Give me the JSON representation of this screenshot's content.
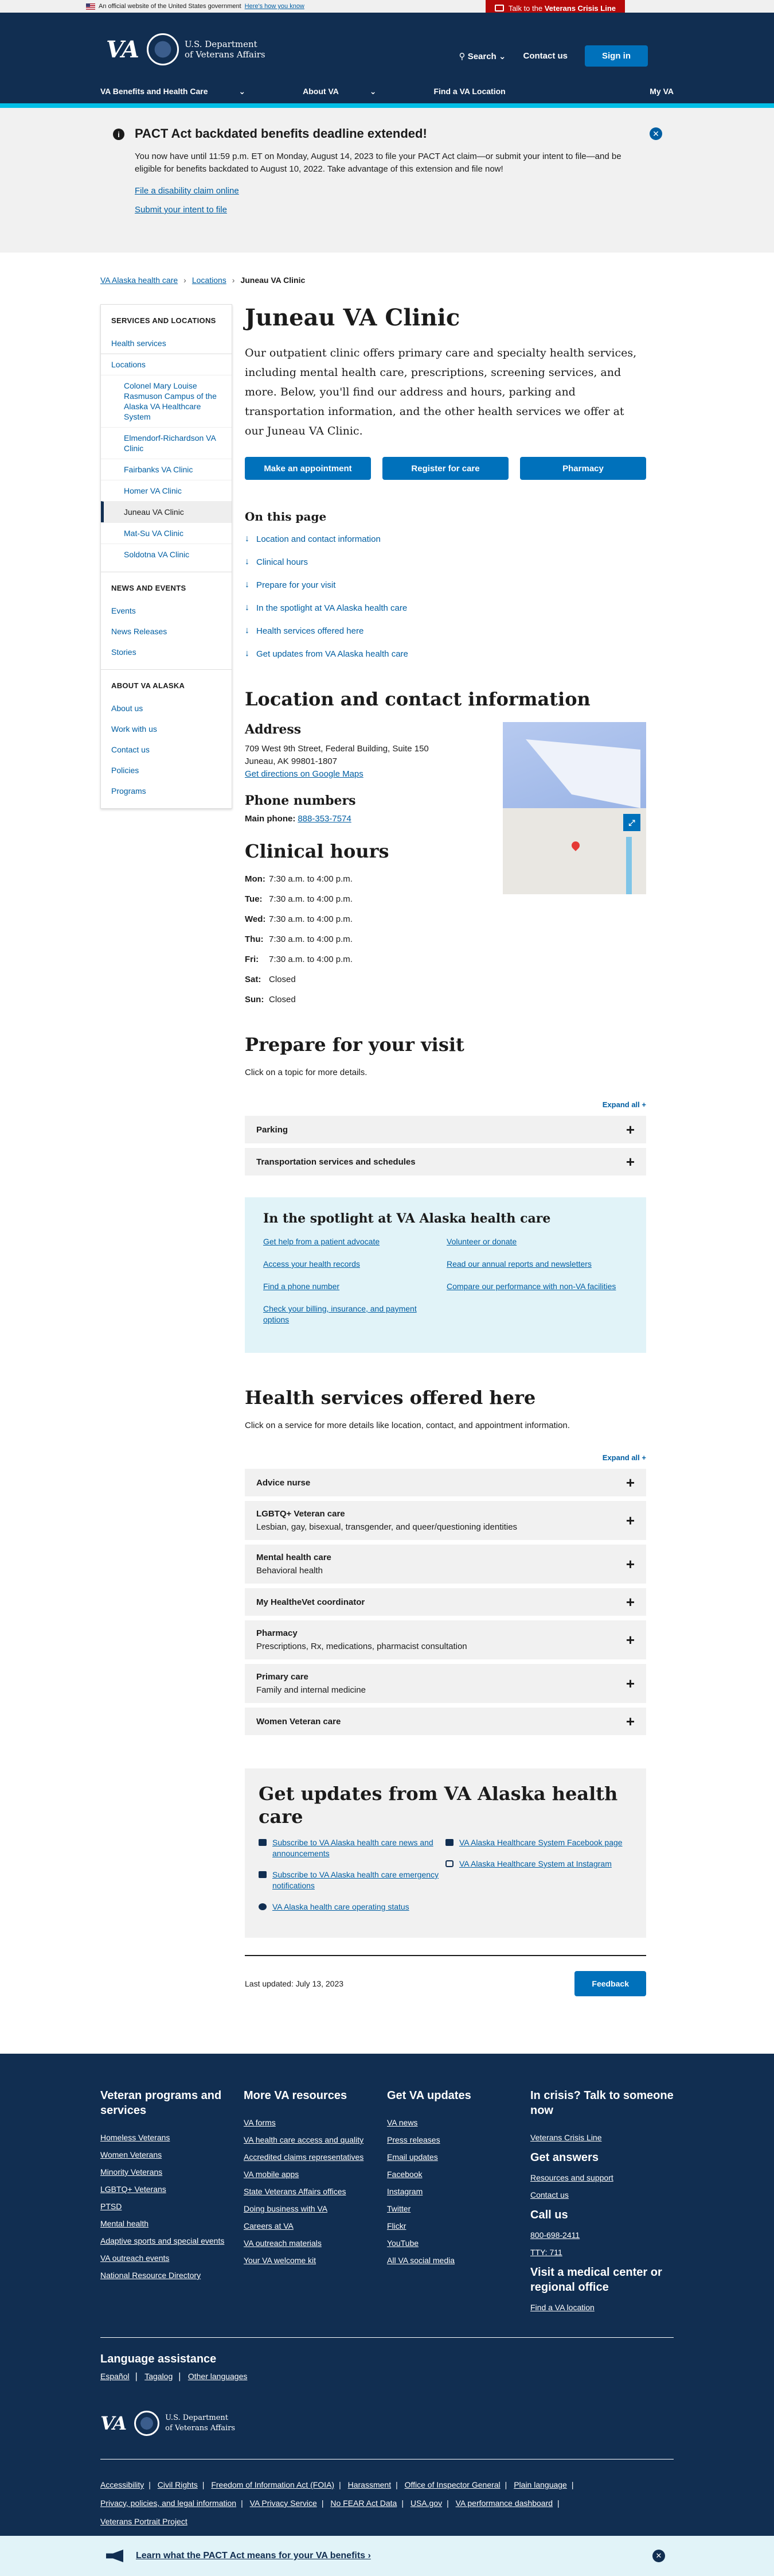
{
  "gov_banner": {
    "text": "An official website of the United States government",
    "how": "Here's how you know"
  },
  "crisis": {
    "prefix": "Talk to the",
    "bold": "Veterans Crisis Line"
  },
  "header": {
    "logo": "VA",
    "dept_line1": "U.S. Department",
    "dept_line2": "of Veterans Affairs",
    "search": "Search",
    "contact": "Contact us",
    "signin": "Sign in",
    "nav": [
      "VA Benefits and Health Care",
      "About VA",
      "Find a VA Location"
    ],
    "myva": "My VA"
  },
  "alert": {
    "title": "PACT Act backdated benefits deadline extended!",
    "body": "You now have until 11:59 p.m. ET on Monday, August 14, 2023 to file your PACT Act claim—or submit your intent to file—and be eligible for benefits backdated to August 10, 2022. Take advantage of this extension and file now!",
    "link1": "File a disability claim online",
    "link2": "Submit your intent to file"
  },
  "breadcrumb": [
    "VA Alaska health care",
    "Locations",
    "Juneau VA Clinic"
  ],
  "sidebar": {
    "heading1": "SERVICES AND LOCATIONS",
    "health_services": "Health services",
    "locations": "Locations",
    "location_items": [
      "Colonel Mary Louise Rasmuson Campus of the Alaska VA Healthcare System",
      "Elmendorf-Richardson VA Clinic",
      "Fairbanks VA Clinic",
      "Homer VA Clinic",
      "Juneau VA Clinic",
      "Mat-Su VA Clinic",
      "Soldotna VA Clinic"
    ],
    "heading2": "NEWS AND EVENTS",
    "news_items": [
      "Events",
      "News Releases",
      "Stories"
    ],
    "heading3": "ABOUT VA ALASKA",
    "about_items": [
      "About us",
      "Work with us",
      "Contact us",
      "Policies",
      "Programs"
    ]
  },
  "main": {
    "title": "Juneau VA Clinic",
    "lead": "Our outpatient clinic offers primary care and specialty health services, including mental health care, prescriptions, screening services, and more. Below, you'll find our address and hours, parking and transportation information, and the other health services we offer at our Juneau VA Clinic.",
    "buttons": [
      "Make an appointment",
      "Register for care",
      "Pharmacy"
    ],
    "otp_title": "On this page",
    "otp": [
      "Location and contact information",
      "Clinical hours",
      "Prepare for your visit",
      "In the spotlight at VA Alaska health care",
      "Health services offered here",
      "Get updates from VA Alaska health care"
    ],
    "loc_title": "Location and contact information",
    "address_title": "Address",
    "address1": "709 West 9th Street, Federal Building, Suite 150",
    "address2": "Juneau, AK 99801-1807",
    "directions": "Get directions on Google Maps",
    "phone_title": "Phone numbers",
    "phone_label": "Main phone:",
    "phone": "888-353-7574",
    "hours_title": "Clinical hours",
    "hours": [
      {
        "day": "Mon:",
        "time": "7:30 a.m. to 4:00 p.m."
      },
      {
        "day": "Tue:",
        "time": "7:30 a.m. to 4:00 p.m."
      },
      {
        "day": "Wed:",
        "time": "7:30 a.m. to 4:00 p.m."
      },
      {
        "day": "Thu:",
        "time": "7:30 a.m. to 4:00 p.m."
      },
      {
        "day": "Fri:",
        "time": "7:30 a.m. to 4:00 p.m."
      },
      {
        "day": "Sat:",
        "time": "Closed"
      },
      {
        "day": "Sun:",
        "time": "Closed"
      }
    ],
    "prepare_title": "Prepare for your visit",
    "prepare_hint": "Click on a topic for more details.",
    "expand_all": "Expand all +",
    "prepare_items": [
      "Parking",
      "Transportation services and schedules"
    ],
    "spot_title": "In the spotlight at VA Alaska health care",
    "spot_left": [
      "Get help from a patient advocate",
      "Access your health records",
      "Find a phone number",
      "Check your billing, insurance, and payment options"
    ],
    "spot_right": [
      "Volunteer or donate",
      "Read our annual reports and newsletters",
      "Compare our performance with non-VA facilities"
    ],
    "hs_title": "Health services offered here",
    "hs_hint": "Click on a service for more details like location, contact, and appointment information.",
    "services": [
      {
        "t": "Advice nurse",
        "s": ""
      },
      {
        "t": "LGBTQ+ Veteran care",
        "s": "Lesbian, gay, bisexual, transgender, and queer/questioning identities"
      },
      {
        "t": "Mental health care",
        "s": "Behavioral health"
      },
      {
        "t": "My HealtheVet coordinator",
        "s": ""
      },
      {
        "t": "Pharmacy",
        "s": "Prescriptions, Rx, medications, pharmacist consultation"
      },
      {
        "t": "Primary care",
        "s": "Family and internal medicine"
      },
      {
        "t": "Women Veteran care",
        "s": ""
      }
    ],
    "updates_title": "Get updates from VA Alaska health care",
    "updates_left": [
      "Subscribe to VA Alaska health care news and announcements",
      "Subscribe to VA Alaska health care emergency notifications",
      "VA Alaska health care operating status"
    ],
    "updates_right": [
      "VA Alaska Healthcare System Facebook page",
      "VA Alaska Healthcare System at Instagram"
    ],
    "last_updated": "Last updated: July 13, 2023",
    "feedback": "Feedback"
  },
  "footer": {
    "col1_title": "Veteran programs and services",
    "col1": [
      "Homeless Veterans",
      "Women Veterans",
      "Minority Veterans",
      "LGBTQ+ Veterans",
      "PTSD",
      "Mental health",
      "Adaptive sports and special events",
      "VA outreach events",
      "National Resource Directory"
    ],
    "col2_title": "More VA resources",
    "col2": [
      "VA forms",
      "VA health care access and quality",
      "Accredited claims representatives",
      "VA mobile apps",
      "State Veterans Affairs offices",
      "Doing business with VA",
      "Careers at VA",
      "VA outreach materials",
      "Your VA welcome kit"
    ],
    "col3_title": "Get VA updates",
    "col3": [
      "VA news",
      "Press releases",
      "Email updates",
      "Facebook",
      "Instagram",
      "Twitter",
      "Flickr",
      "YouTube",
      "All VA social media"
    ],
    "col4_title": "In crisis? Talk to someone now",
    "col4_link": "Veterans Crisis Line",
    "answers_title": "Get answers",
    "answers": [
      "Resources and support",
      "Contact us"
    ],
    "call_title": "Call us",
    "call": [
      "800-698-2411",
      "TTY: 711"
    ],
    "visit_title": "Visit a medical center or regional office",
    "visit_link": "Find a VA location",
    "lang_title": "Language assistance",
    "langs": [
      "Español",
      "Tagalog",
      "Other languages"
    ],
    "bottom_links": [
      "Accessibility",
      "Civil Rights",
      "Freedom of Information Act (FOIA)",
      "Harassment",
      "Office of Inspector General",
      "Plain language",
      "Privacy, policies, and legal information",
      "VA Privacy Service",
      "No FEAR Act Data",
      "USA.gov",
      "VA performance dashboard",
      "Veterans Portrait Project"
    ]
  },
  "pact_bar": {
    "text": "Learn what the PACT Act means for your VA benefits",
    "arrow": "›"
  },
  "colors": {
    "navy": "#112e51",
    "primary": "#0071bb",
    "cyan": "#02bfe7",
    "crisis_red": "#b50909"
  }
}
